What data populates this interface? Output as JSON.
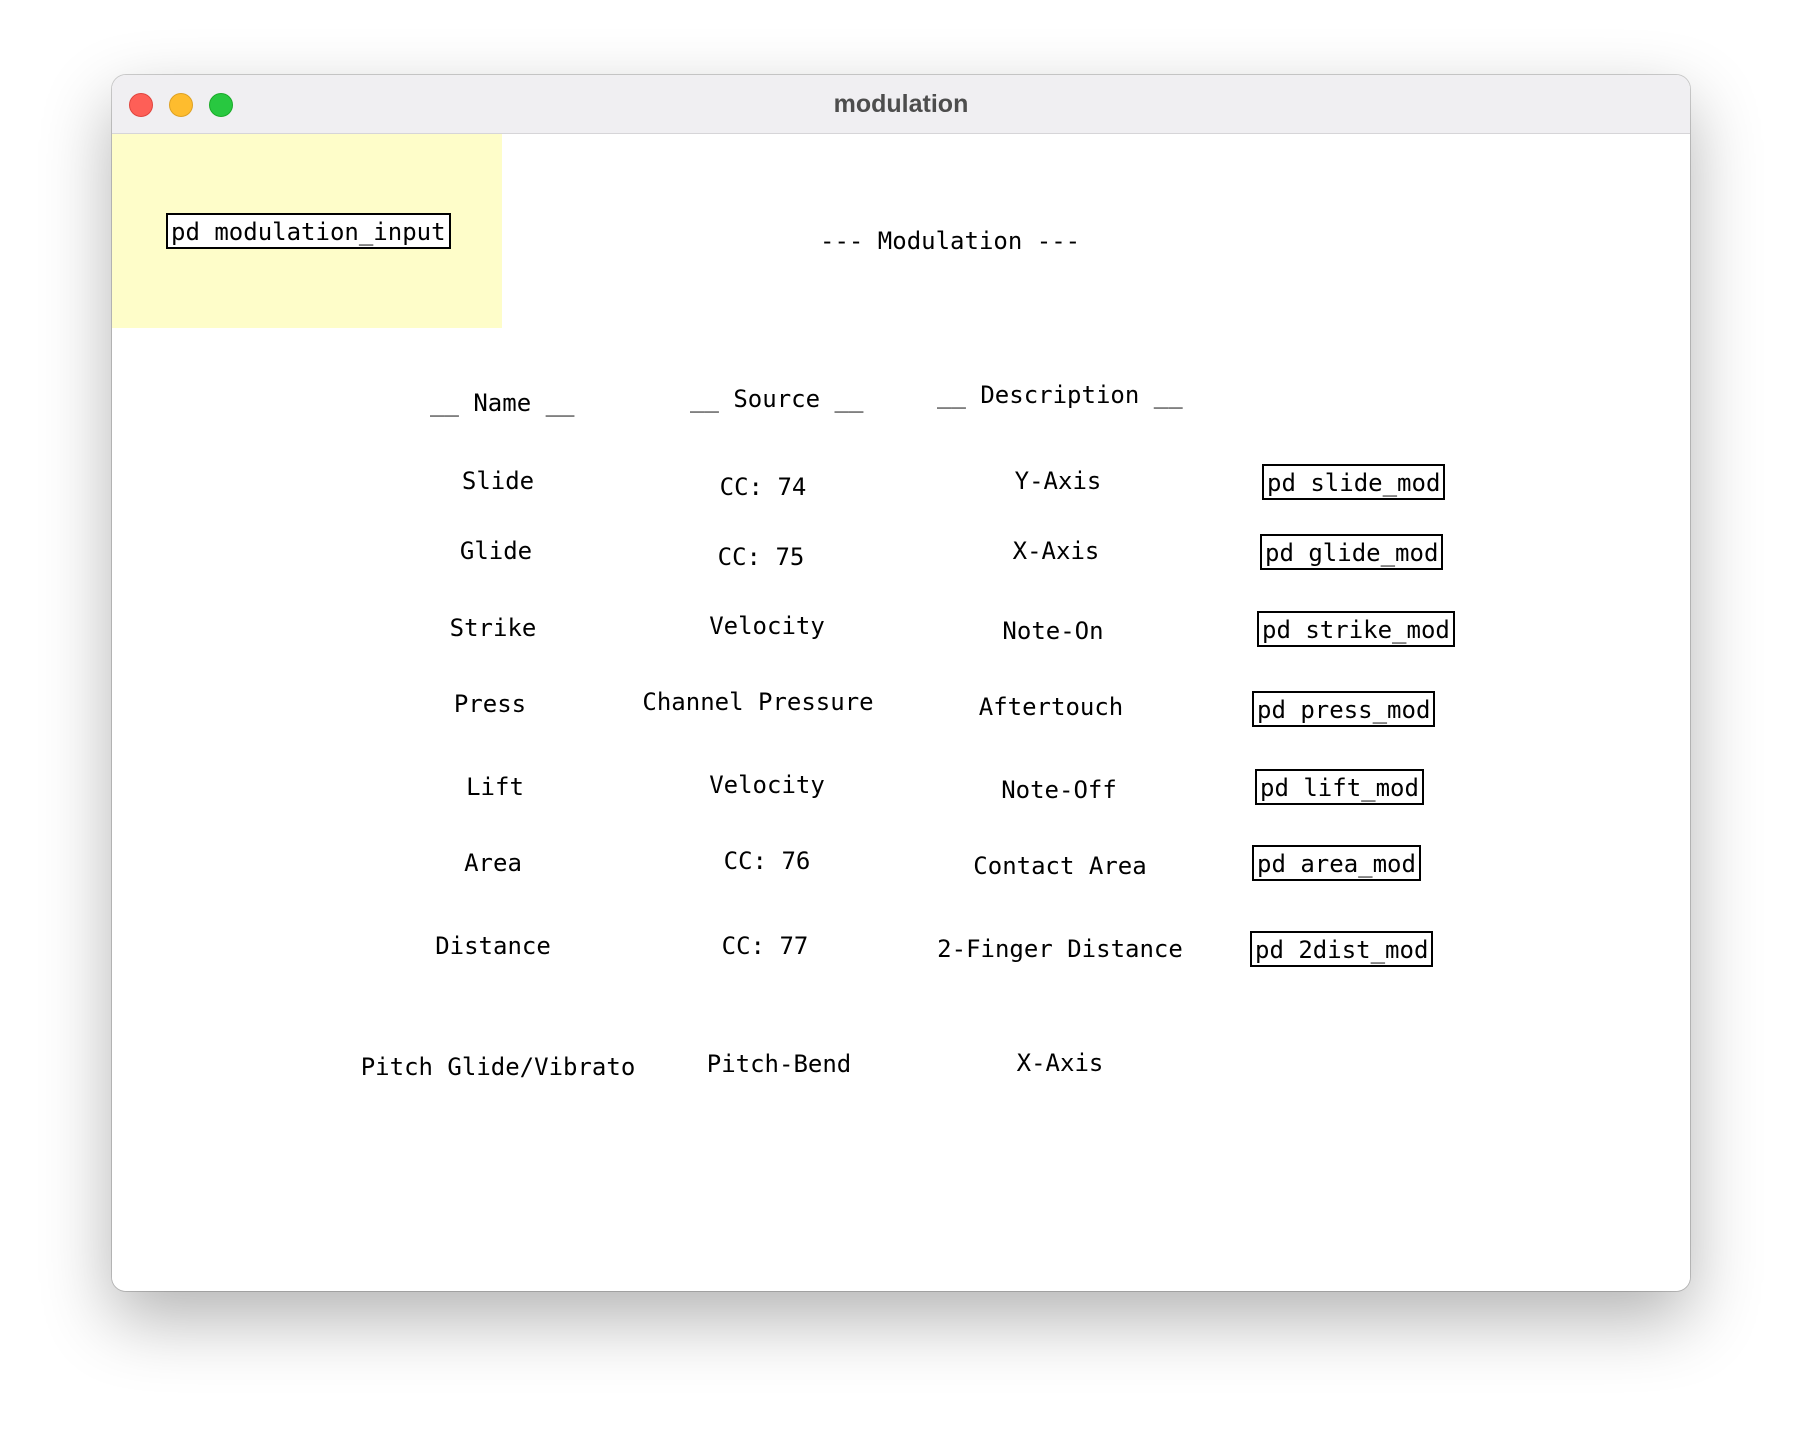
{
  "window": {
    "title": "modulation"
  },
  "canvas": {
    "input_object": "pd modulation_input",
    "heading": "--- Modulation ---",
    "columns": {
      "name": "__ Name __",
      "source": "__ Source __",
      "description": "__ Description __"
    },
    "rows": [
      {
        "name": "Slide",
        "source": "CC: 74",
        "description": "Y-Axis",
        "object": "pd slide_mod"
      },
      {
        "name": "Glide",
        "source": "CC: 75",
        "description": "X-Axis",
        "object": "pd glide_mod"
      },
      {
        "name": "Strike",
        "source": "Velocity",
        "description": "Note-On",
        "object": "pd strike_mod"
      },
      {
        "name": "Press",
        "source": "Channel Pressure",
        "description": "Aftertouch",
        "object": "pd press_mod"
      },
      {
        "name": "Lift",
        "source": "Velocity",
        "description": "Note-Off",
        "object": "pd lift_mod"
      },
      {
        "name": "Area",
        "source": "CC: 76",
        "description": "Contact Area",
        "object": "pd area_mod"
      },
      {
        "name": "Distance",
        "source": "CC: 77",
        "description": "2-Finger Distance",
        "object": "pd 2dist_mod"
      },
      {
        "name": "Pitch Glide/Vibrato",
        "source": "Pitch-Bend",
        "description": "X-Axis"
      }
    ]
  }
}
